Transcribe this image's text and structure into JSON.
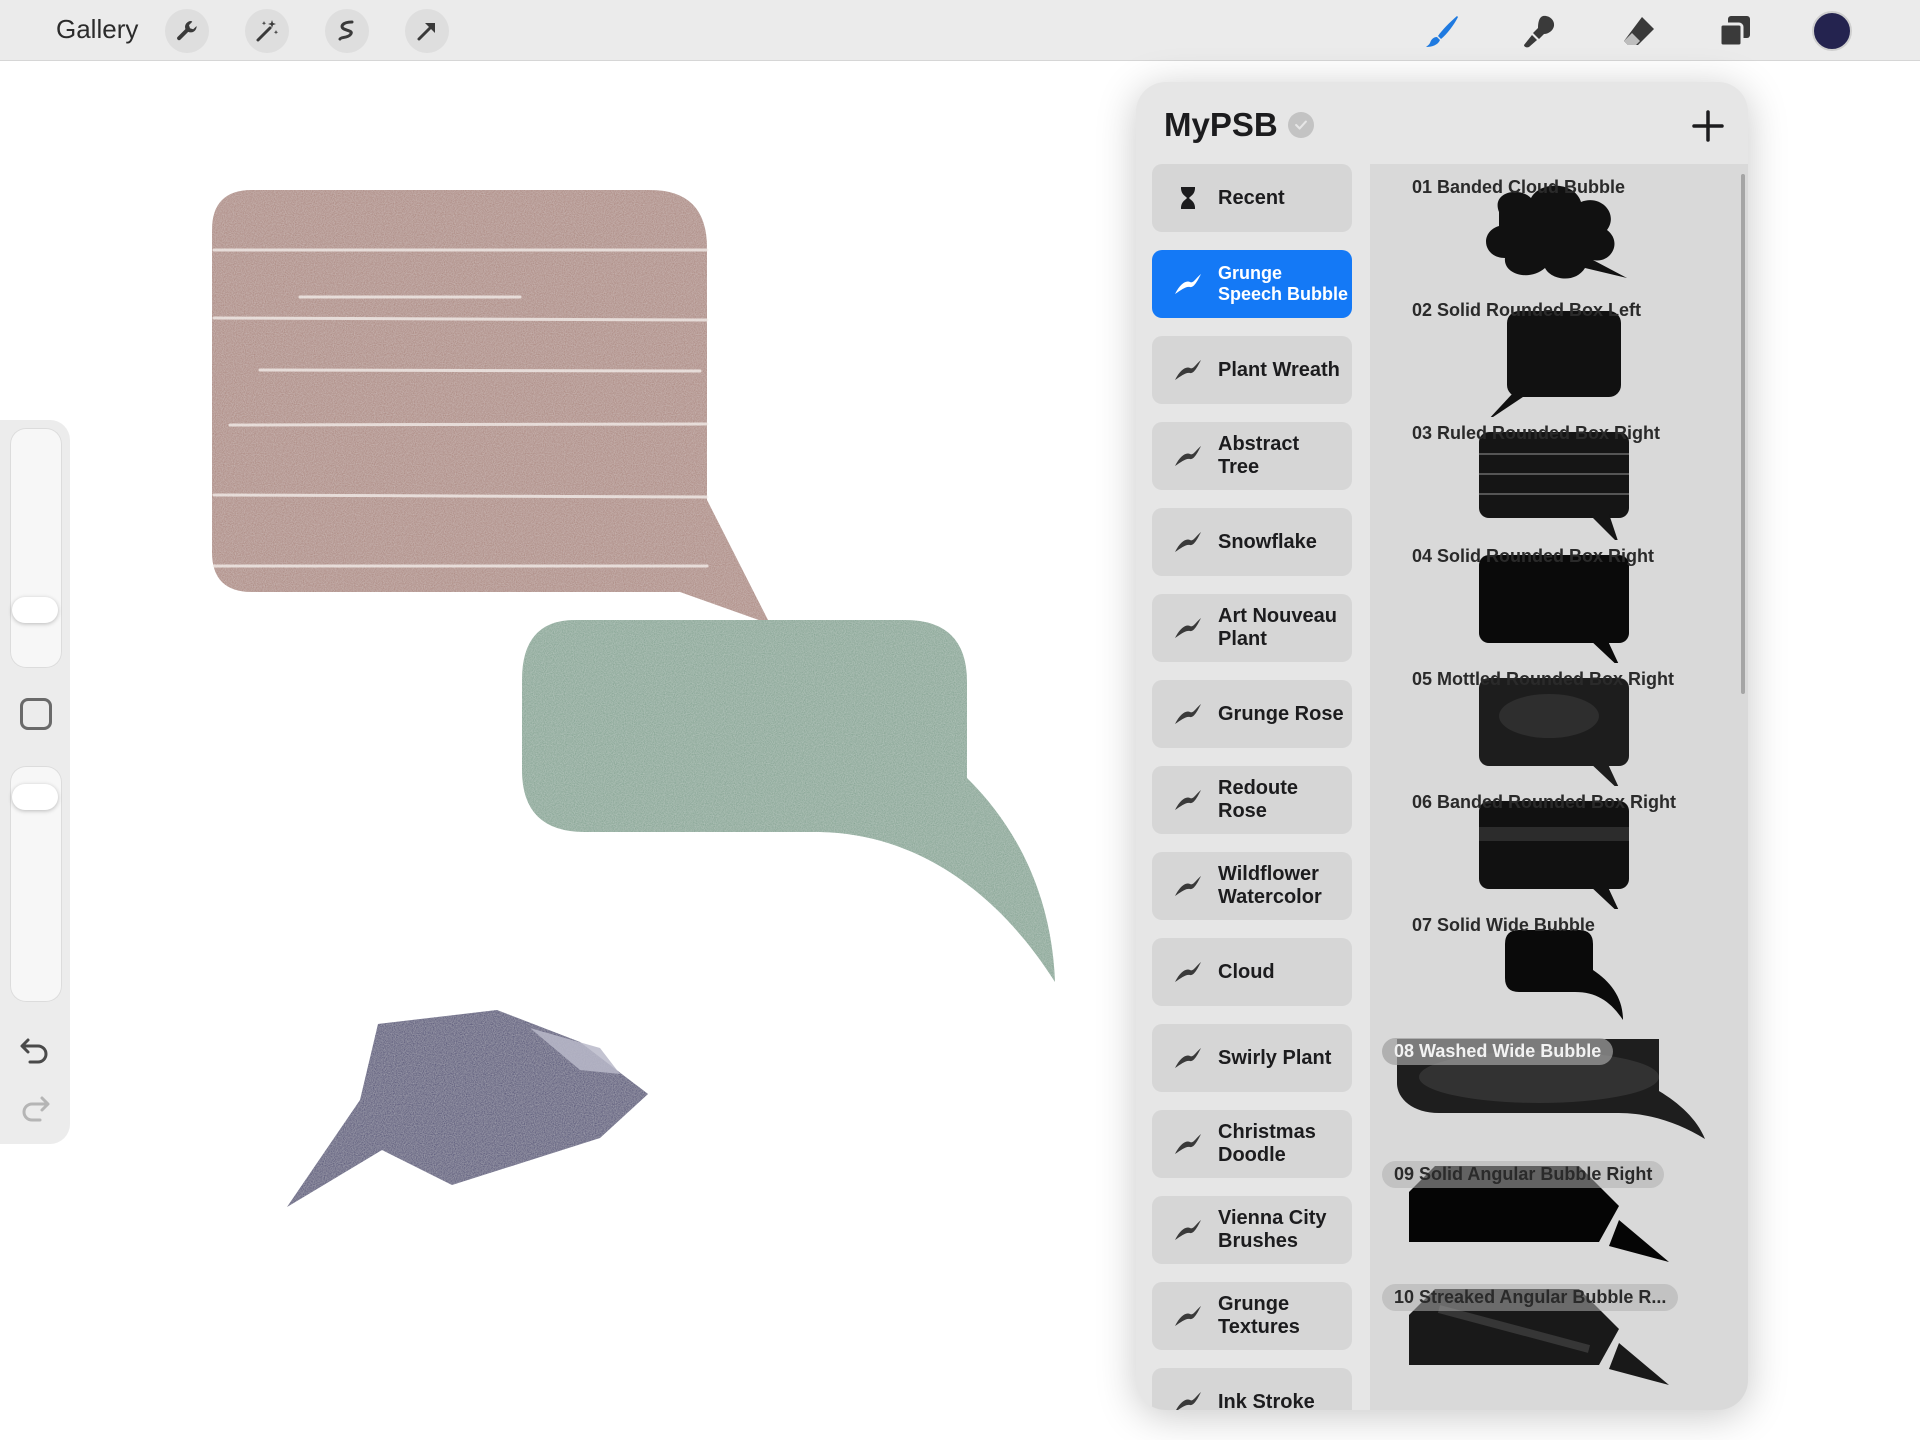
{
  "toolbar": {
    "gallery_label": "Gallery",
    "left_tools": [
      {
        "name": "actions-wrench-icon"
      },
      {
        "name": "adjustments-wand-icon"
      },
      {
        "name": "selection-icon"
      },
      {
        "name": "transform-arrow-icon"
      }
    ],
    "right_tools": [
      {
        "name": "paint-brush-icon",
        "color": "#1f7ae0"
      },
      {
        "name": "smudge-icon",
        "color": "#3a3a3a"
      },
      {
        "name": "eraser-icon",
        "color": "#3a3a3a"
      },
      {
        "name": "layers-icon",
        "color": "#3a3a3a"
      }
    ],
    "current_color": "#24234f"
  },
  "canvas": {
    "shapes": [
      {
        "name": "mauve-ruled-speech-bubble",
        "color": "#a78077"
      },
      {
        "name": "sage-rounded-speech-bubble",
        "color": "#7b9f8c"
      },
      {
        "name": "navy-angular-speech-bubble",
        "color": "#3c3b6c"
      }
    ]
  },
  "sidebar": {
    "brush_size_level": 0.2,
    "opacity_level": 0.93,
    "modify_icon": "square-modify-icon",
    "undo_icon": "undo-icon",
    "redo_icon": "redo-icon"
  },
  "brush_library": {
    "title": "MyPSB",
    "add_icon": "plus-icon",
    "accent_color": "#1479f6",
    "sets": [
      {
        "label": "Recent",
        "icon": "hourglass-icon"
      },
      {
        "label": "Grunge\nSpeech Bubble",
        "icon": "brush-stroke-icon",
        "active": true
      },
      {
        "label": "Plant Wreath",
        "icon": "brush-stroke-icon"
      },
      {
        "label": "Abstract\nTree",
        "icon": "brush-stroke-icon"
      },
      {
        "label": "Snowflake",
        "icon": "brush-stroke-icon"
      },
      {
        "label": "Art Nouveau\nPlant",
        "icon": "brush-stroke-icon"
      },
      {
        "label": "Grunge Rose",
        "icon": "brush-stroke-icon"
      },
      {
        "label": "Redoute\nRose",
        "icon": "brush-stroke-icon"
      },
      {
        "label": "Wildflower\nWatercolor",
        "icon": "brush-stroke-icon"
      },
      {
        "label": "Cloud",
        "icon": "brush-stroke-icon"
      },
      {
        "label": "Swirly Plant",
        "icon": "brush-stroke-icon"
      },
      {
        "label": "Christmas\nDoodle",
        "icon": "brush-stroke-icon"
      },
      {
        "label": "Vienna City\nBrushes",
        "icon": "brush-stroke-icon"
      },
      {
        "label": "Grunge\nTextures",
        "icon": "brush-stroke-icon"
      },
      {
        "label": "Ink Stroke",
        "icon": "brush-stroke-icon"
      }
    ],
    "brushes": [
      {
        "name": "01 Banded Cloud Bubble"
      },
      {
        "name": "02 Solid Rounded Box Left"
      },
      {
        "name": "03 Ruled Rounded Box Right"
      },
      {
        "name": "04 Solid Rounded Box Right"
      },
      {
        "name": "05 Mottled Rounded Box Right"
      },
      {
        "name": "06 Banded Rounded Box Right"
      },
      {
        "name": "07 Solid Wide Bubble"
      },
      {
        "name": "08 Washed Wide Bubble"
      },
      {
        "name": "09 Solid Angular Bubble Right"
      },
      {
        "name": "10 Streaked Angular Bubble R..."
      }
    ]
  }
}
